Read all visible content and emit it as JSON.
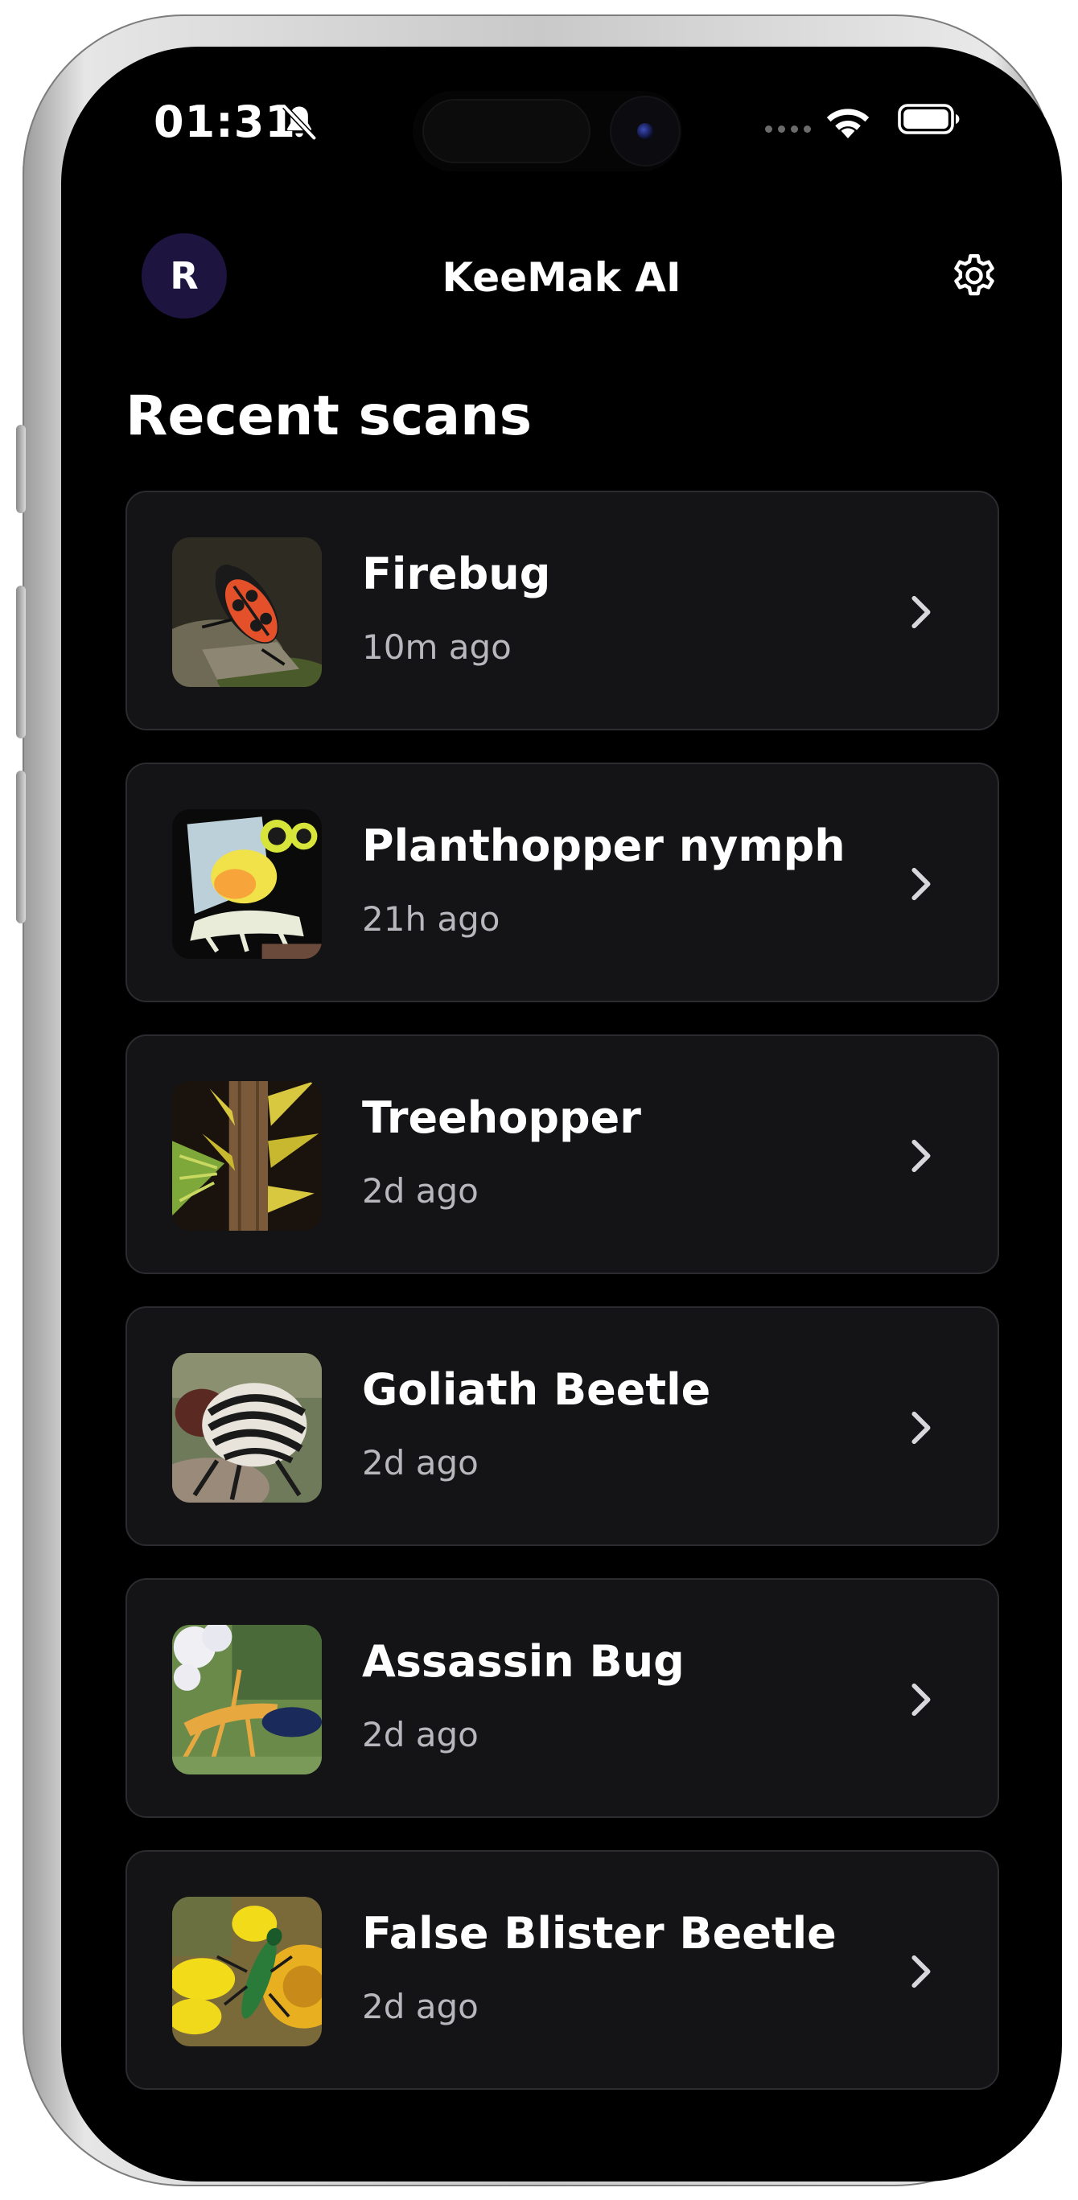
{
  "status_bar": {
    "time": "01:31"
  },
  "header": {
    "avatar_initial": "R",
    "title": "KeeMak AI"
  },
  "section_title": "Recent scans",
  "scans": [
    {
      "name": "Firebug",
      "time": "10m ago",
      "icon": "chevron-right-icon"
    },
    {
      "name": "Planthopper nymph",
      "time": "21h ago",
      "icon": "chevron-right-icon"
    },
    {
      "name": "Treehopper",
      "time": "2d ago",
      "icon": "chevron-right-icon"
    },
    {
      "name": "Goliath Beetle",
      "time": "2d ago",
      "icon": "chevron-right-icon"
    },
    {
      "name": "Assassin Bug",
      "time": "2d ago",
      "icon": "chevron-right-icon"
    },
    {
      "name": "False Blister Beetle",
      "time": "2d ago",
      "icon": "chevron-right-icon"
    }
  ],
  "colors": {
    "background": "#000000",
    "card": "#141416",
    "card_border": "#2b2b30",
    "avatar": "#1d1440",
    "secondary_text": "#b7b7bd"
  }
}
